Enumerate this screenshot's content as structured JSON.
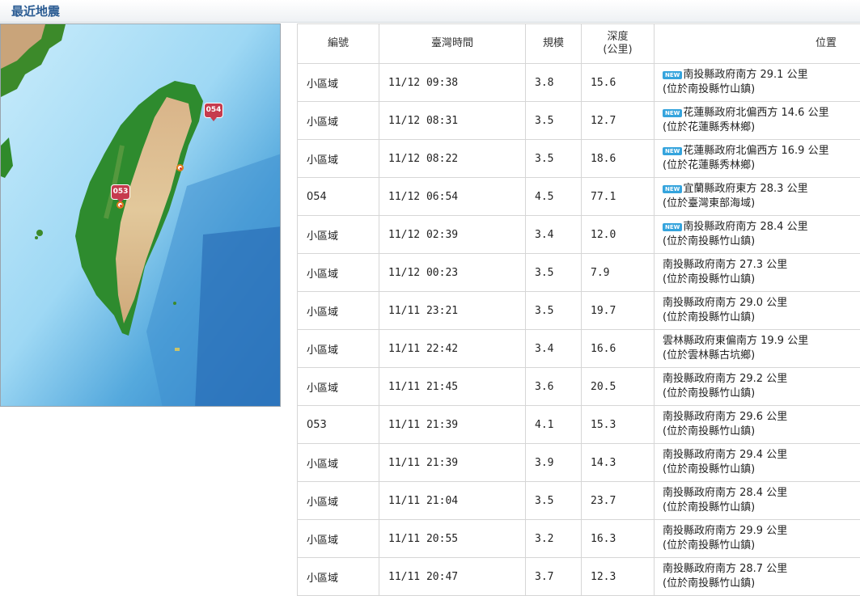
{
  "page": {
    "title": "最近地震"
  },
  "map": {
    "markers": [
      {
        "label": "054"
      },
      {
        "label": "053"
      }
    ]
  },
  "table": {
    "headers": {
      "id": "編號",
      "time": "臺灣時間",
      "magnitude": "規模",
      "depth_line1": "深度",
      "depth_line2": "(公里)",
      "location": "位置"
    },
    "new_badge": "NEW",
    "rows": [
      {
        "id": "小區域",
        "time": "11/12 09:38",
        "magnitude": "3.8",
        "depth": "15.6",
        "is_new": true,
        "loc1": "南投縣政府南方 29.1 公里",
        "loc2": "(位於南投縣竹山鎮)"
      },
      {
        "id": "小區域",
        "time": "11/12 08:31",
        "magnitude": "3.5",
        "depth": "12.7",
        "is_new": true,
        "loc1": "花蓮縣政府北偏西方 14.6 公里",
        "loc2": "(位於花蓮縣秀林鄉)"
      },
      {
        "id": "小區域",
        "time": "11/12 08:22",
        "magnitude": "3.5",
        "depth": "18.6",
        "is_new": true,
        "loc1": "花蓮縣政府北偏西方 16.9 公里",
        "loc2": "(位於花蓮縣秀林鄉)"
      },
      {
        "id": "054",
        "time": "11/12 06:54",
        "magnitude": "4.5",
        "depth": "77.1",
        "is_new": true,
        "loc1": "宜蘭縣政府東方 28.3 公里",
        "loc2": "(位於臺灣東部海域)"
      },
      {
        "id": "小區域",
        "time": "11/12 02:39",
        "magnitude": "3.4",
        "depth": "12.0",
        "is_new": true,
        "loc1": "南投縣政府南方 28.4 公里",
        "loc2": "(位於南投縣竹山鎮)"
      },
      {
        "id": "小區域",
        "time": "11/12 00:23",
        "magnitude": "3.5",
        "depth": "7.9",
        "is_new": false,
        "loc1": "南投縣政府南方 27.3 公里",
        "loc2": "(位於南投縣竹山鎮)"
      },
      {
        "id": "小區域",
        "time": "11/11 23:21",
        "magnitude": "3.5",
        "depth": "19.7",
        "is_new": false,
        "loc1": "南投縣政府南方 29.0 公里",
        "loc2": "(位於南投縣竹山鎮)"
      },
      {
        "id": "小區域",
        "time": "11/11 22:42",
        "magnitude": "3.4",
        "depth": "16.6",
        "is_new": false,
        "loc1": "雲林縣政府東偏南方 19.9 公里",
        "loc2": "(位於雲林縣古坑鄉)"
      },
      {
        "id": "小區域",
        "time": "11/11 21:45",
        "magnitude": "3.6",
        "depth": "20.5",
        "is_new": false,
        "loc1": "南投縣政府南方 29.2 公里",
        "loc2": "(位於南投縣竹山鎮)"
      },
      {
        "id": "053",
        "time": "11/11 21:39",
        "magnitude": "4.1",
        "depth": "15.3",
        "is_new": false,
        "loc1": "南投縣政府南方 29.6 公里",
        "loc2": "(位於南投縣竹山鎮)"
      },
      {
        "id": "小區域",
        "time": "11/11 21:39",
        "magnitude": "3.9",
        "depth": "14.3",
        "is_new": false,
        "loc1": "南投縣政府南方 29.4 公里",
        "loc2": "(位於南投縣竹山鎮)"
      },
      {
        "id": "小區域",
        "time": "11/11 21:04",
        "magnitude": "3.5",
        "depth": "23.7",
        "is_new": false,
        "loc1": "南投縣政府南方 28.4 公里",
        "loc2": "(位於南投縣竹山鎮)"
      },
      {
        "id": "小區域",
        "time": "11/11 20:55",
        "magnitude": "3.2",
        "depth": "16.3",
        "is_new": false,
        "loc1": "南投縣政府南方 29.9 公里",
        "loc2": "(位於南投縣竹山鎮)"
      },
      {
        "id": "小區域",
        "time": "11/11 20:47",
        "magnitude": "3.7",
        "depth": "12.3",
        "is_new": false,
        "loc1": "南投縣政府南方 28.7 公里",
        "loc2": "(位於南投縣竹山鎮)"
      }
    ]
  }
}
